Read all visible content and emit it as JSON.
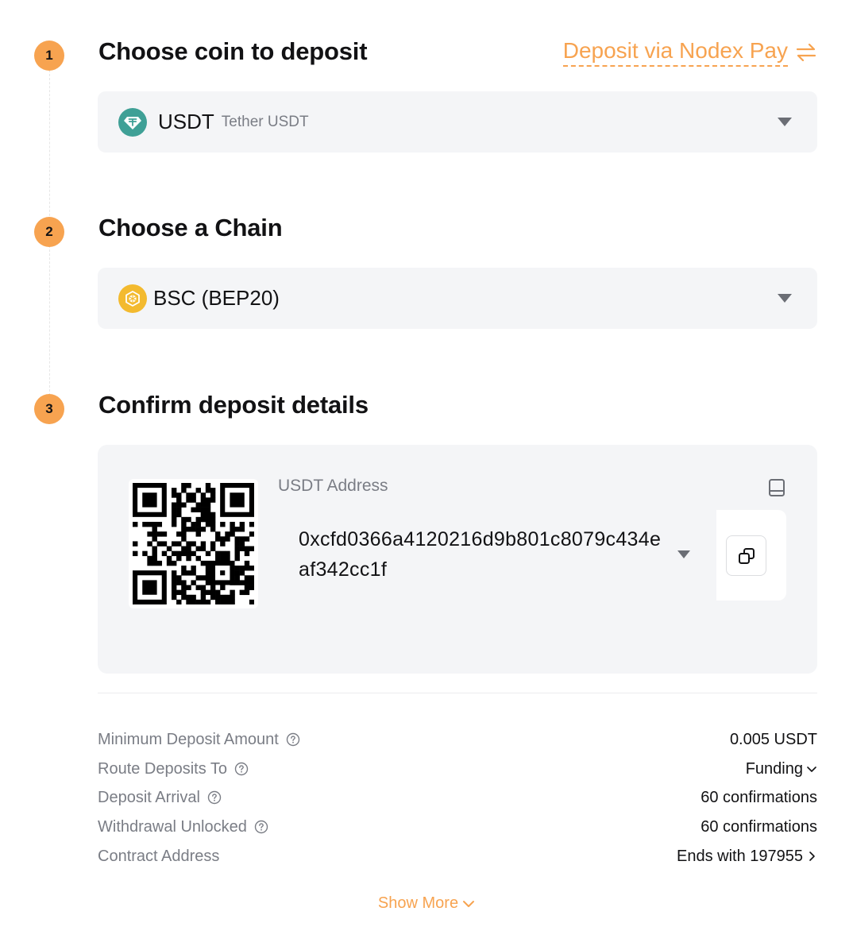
{
  "steps": [
    {
      "number": "1",
      "title": "Choose coin to deposit"
    },
    {
      "number": "2",
      "title": "Choose a Chain"
    },
    {
      "number": "3",
      "title": "Confirm deposit details"
    }
  ],
  "nodex_link": {
    "label": "Deposit via Nodex Pay"
  },
  "coin_select": {
    "symbol": "USDT",
    "name": "Tether USDT",
    "icon": "tether-icon"
  },
  "chain_select": {
    "label": "BSC (BEP20)",
    "icon": "bnb-icon"
  },
  "address": {
    "label": "USDT Address",
    "value": "0xcfd0366a4120216d9b801c8079c434eaf342cc1f"
  },
  "details": [
    {
      "label": "Minimum Deposit Amount",
      "value": "0.005 USDT",
      "help": true,
      "suffix": ""
    },
    {
      "label": "Route Deposits To",
      "value": "Funding",
      "help": true,
      "suffix": "chevron-down"
    },
    {
      "label": "Deposit Arrival",
      "value": "60 confirmations",
      "help": true,
      "suffix": ""
    },
    {
      "label": "Withdrawal Unlocked",
      "value": "60 confirmations",
      "help": true,
      "suffix": ""
    },
    {
      "label": "Contract Address",
      "value": "Ends with 197955",
      "help": false,
      "suffix": "chevron-right"
    }
  ],
  "show_more": "Show More",
  "colors": {
    "accent": "#f7a350",
    "tether": "#3fa096",
    "bnb": "#f3ba2f",
    "panel": "#f4f5f7"
  }
}
